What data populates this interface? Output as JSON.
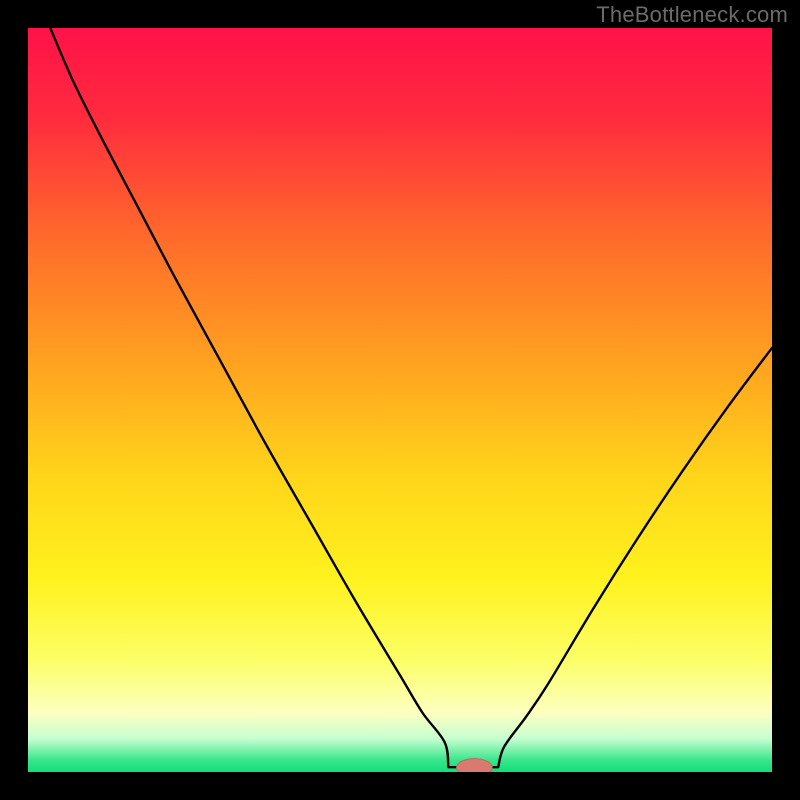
{
  "watermark": "TheBottleneck.com",
  "colors": {
    "frame": "#000000",
    "watermark": "#6b6b6b",
    "curve": "#000000",
    "marker_fill": "#d87a6f",
    "marker_stroke": "#c06a60",
    "gradient_stops": [
      {
        "offset": 0.0,
        "color": "#ff1248"
      },
      {
        "offset": 0.12,
        "color": "#ff2b3e"
      },
      {
        "offset": 0.28,
        "color": "#ff6a2b"
      },
      {
        "offset": 0.45,
        "color": "#ffa220"
      },
      {
        "offset": 0.6,
        "color": "#ffd41a"
      },
      {
        "offset": 0.74,
        "color": "#fff21e"
      },
      {
        "offset": 0.85,
        "color": "#fcff66"
      },
      {
        "offset": 0.92,
        "color": "#fdffc0"
      },
      {
        "offset": 0.955,
        "color": "#c7ffd1"
      },
      {
        "offset": 0.985,
        "color": "#35e58a"
      },
      {
        "offset": 1.0,
        "color": "#12df78"
      }
    ]
  },
  "chart_data": {
    "type": "line",
    "title": "",
    "xlabel": "",
    "ylabel": "",
    "xlim": [
      0,
      100
    ],
    "ylim": [
      0,
      100
    ],
    "grid": false,
    "legend": false,
    "series": [
      {
        "name": "bottleneck-curve",
        "x": [
          3,
          6,
          10,
          15,
          20,
          26,
          32,
          38,
          44,
          50,
          53,
          56,
          58,
          59,
          61,
          62,
          64,
          67,
          70,
          76,
          82,
          88,
          94,
          100
        ],
        "y": [
          100,
          93,
          85,
          75.5,
          66,
          55,
          44,
          33.5,
          23,
          13,
          8,
          4,
          1.6,
          0.8,
          0.8,
          1.6,
          3.4,
          7.5,
          12,
          22,
          31.5,
          40.5,
          49,
          57
        ]
      }
    ],
    "marker": {
      "x": 60,
      "y": 0.6,
      "rx": 2.4,
      "ry": 1.2
    },
    "flat_bottom": {
      "x0": 56.5,
      "x1": 63.2,
      "y": 0.65
    }
  }
}
